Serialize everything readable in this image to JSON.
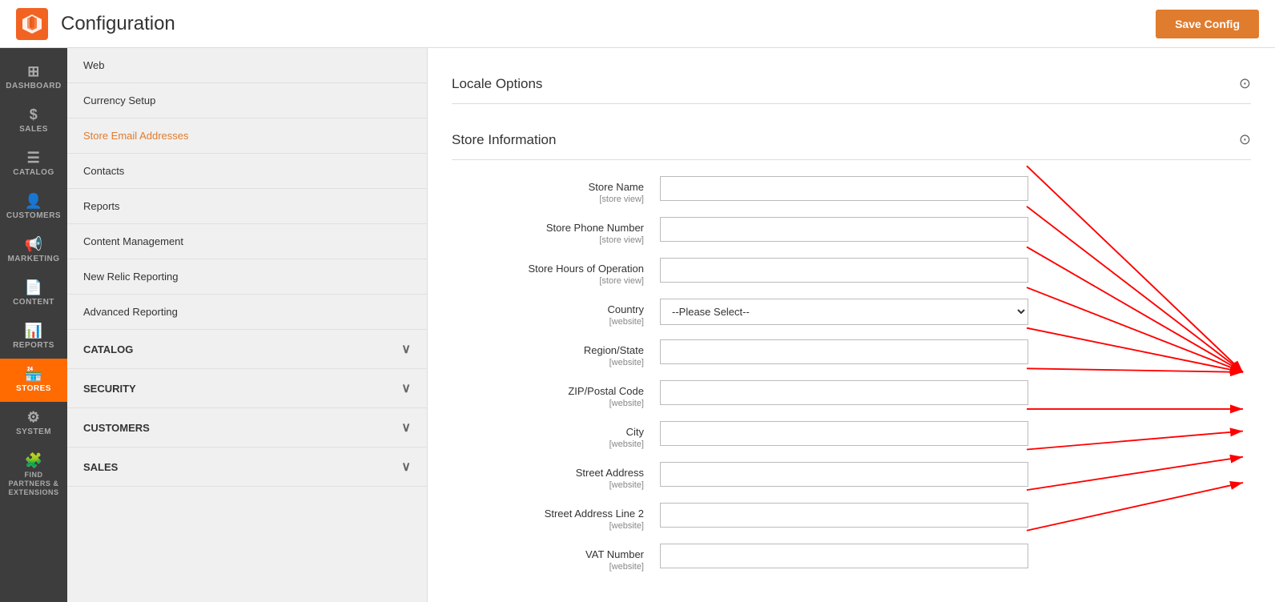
{
  "header": {
    "title": "Configuration",
    "save_button_label": "Save Config",
    "logo_alt": "Magento Logo"
  },
  "left_nav": {
    "items": [
      {
        "id": "dashboard",
        "label": "DASHBOARD",
        "icon": "⊞"
      },
      {
        "id": "sales",
        "label": "SALES",
        "icon": "$"
      },
      {
        "id": "catalog",
        "label": "CATALOG",
        "icon": "☰"
      },
      {
        "id": "customers",
        "label": "CUSTOMERS",
        "icon": "👤"
      },
      {
        "id": "marketing",
        "label": "MARKETING",
        "icon": "📢"
      },
      {
        "id": "content",
        "label": "CONTENT",
        "icon": "📄"
      },
      {
        "id": "reports",
        "label": "REPORTS",
        "icon": "📊"
      },
      {
        "id": "stores",
        "label": "STORES",
        "icon": "🏪",
        "active": true
      },
      {
        "id": "system",
        "label": "SYSTEM",
        "icon": "⚙"
      },
      {
        "id": "find-partners",
        "label": "FIND PARTNERS & EXTENSIONS",
        "icon": "🧩"
      }
    ]
  },
  "sidebar": {
    "menu_items": [
      {
        "id": "web",
        "label": "Web",
        "active_link": false
      },
      {
        "id": "currency-setup",
        "label": "Currency Setup",
        "active_link": false
      },
      {
        "id": "store-email",
        "label": "Store Email Addresses",
        "active_link": true
      },
      {
        "id": "contacts",
        "label": "Contacts",
        "active_link": false
      },
      {
        "id": "reports",
        "label": "Reports",
        "active_link": false
      },
      {
        "id": "content-mgmt",
        "label": "Content Management",
        "active_link": false
      },
      {
        "id": "new-relic",
        "label": "New Relic Reporting",
        "active_link": false
      },
      {
        "id": "advanced-reporting",
        "label": "Advanced Reporting",
        "active_link": false
      }
    ],
    "sections": [
      {
        "id": "catalog",
        "label": "CATALOG"
      },
      {
        "id": "security",
        "label": "SECURITY"
      },
      {
        "id": "customers",
        "label": "CUSTOMERS"
      },
      {
        "id": "sales",
        "label": "SALES"
      }
    ]
  },
  "main": {
    "locale_options": {
      "title": "Locale Options",
      "collapsed": false
    },
    "store_information": {
      "title": "Store Information",
      "fields": [
        {
          "id": "store-name",
          "label": "Store Name",
          "scope": "[store view]",
          "type": "text",
          "value": ""
        },
        {
          "id": "store-phone",
          "label": "Store Phone Number",
          "scope": "[store view]",
          "type": "text",
          "value": ""
        },
        {
          "id": "store-hours",
          "label": "Store Hours of Operation",
          "scope": "[store view]",
          "type": "text",
          "value": ""
        },
        {
          "id": "country",
          "label": "Country",
          "scope": "[website]",
          "type": "select",
          "value": "--Please Select--"
        },
        {
          "id": "region-state",
          "label": "Region/State",
          "scope": "[website]",
          "type": "text",
          "value": ""
        },
        {
          "id": "zip-postal",
          "label": "ZIP/Postal Code",
          "scope": "[website]",
          "type": "text",
          "value": ""
        },
        {
          "id": "city",
          "label": "City",
          "scope": "[website]",
          "type": "text",
          "value": ""
        },
        {
          "id": "street-address",
          "label": "Street Address",
          "scope": "[website]",
          "type": "text",
          "value": ""
        },
        {
          "id": "street-address-2",
          "label": "Street Address Line 2",
          "scope": "[website]",
          "type": "text",
          "value": ""
        },
        {
          "id": "vat-number",
          "label": "VAT Number",
          "scope": "[website]",
          "type": "text",
          "value": ""
        }
      ]
    }
  }
}
